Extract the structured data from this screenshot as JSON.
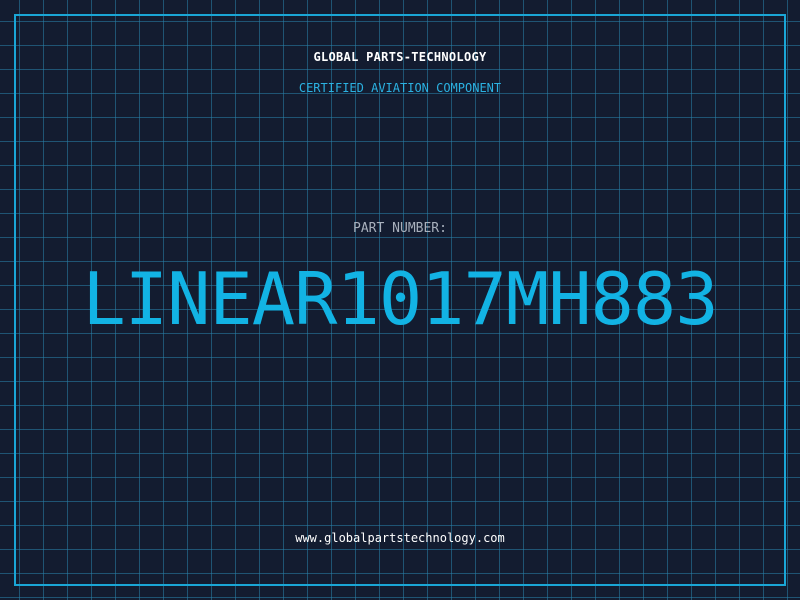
{
  "header": {
    "company": "GLOBAL PARTS-TECHNOLOGY",
    "subtitle": "CERTIFIED AVIATION COMPONENT"
  },
  "part": {
    "label": "PART NUMBER:",
    "number": "LINEAR1017MH883"
  },
  "footer": {
    "website": "www.globalpartstechnology.com"
  },
  "colors": {
    "background": "#131c30",
    "grid": "#2882aa",
    "accent": "#12b3e4",
    "text": "#ffffff",
    "muted": "#a8b0bc"
  }
}
